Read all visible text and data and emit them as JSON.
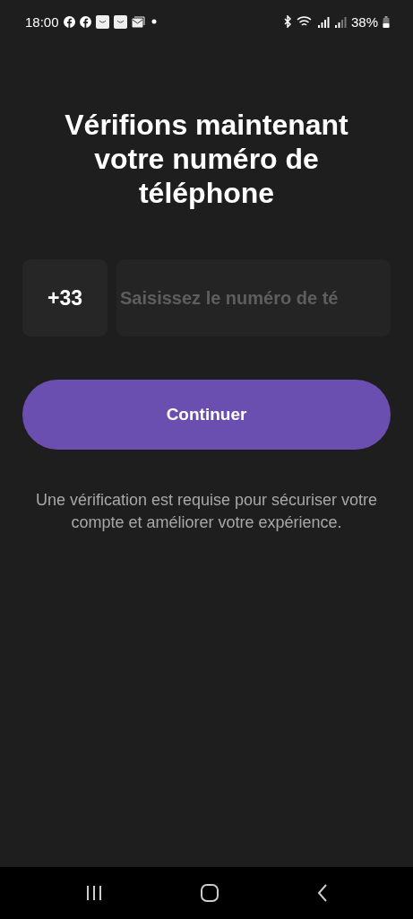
{
  "status_bar": {
    "time": "18:00",
    "battery": "38%"
  },
  "title": "Vérifions maintenant votre numéro de téléphone",
  "phone": {
    "country_code": "+33",
    "placeholder": "Saisissez le numéro de té"
  },
  "continue_button": "Continuer",
  "notice": "Une vérification est requise pour sécuriser votre compte et améliorer votre expérience."
}
